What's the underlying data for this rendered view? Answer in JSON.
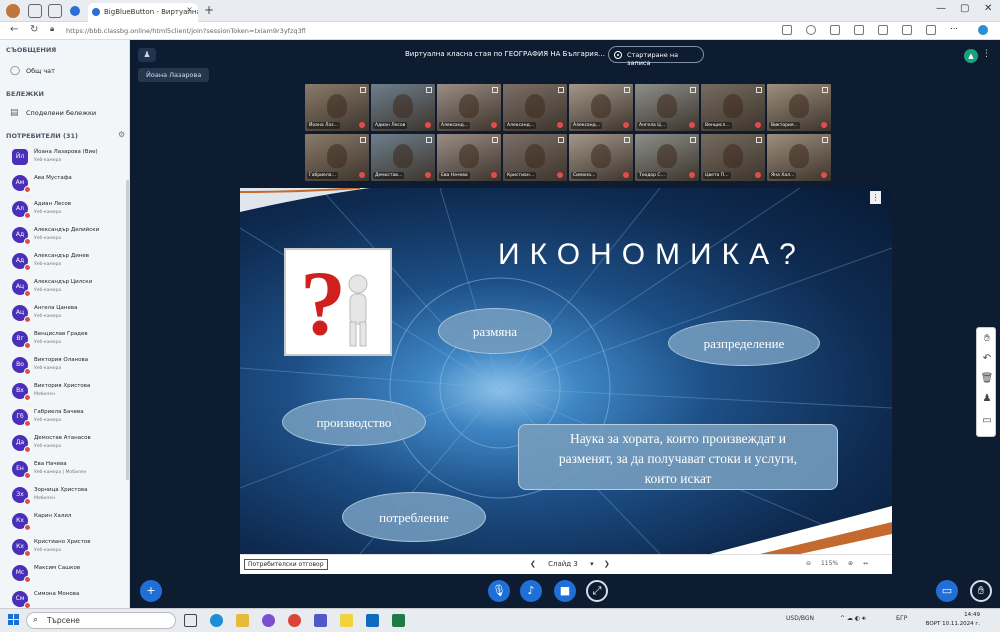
{
  "browser": {
    "tab_title": "BigBlueButton - Виртуална …",
    "tab_close": "×",
    "new_tab": "+",
    "url": "https://bbb.classbg.online/html5client/join?sessionToken=txiam9r3yfzq3fl"
  },
  "sidebar": {
    "messages_header": "СЪОБЩЕНИЯ",
    "public_chat": "Общ чат",
    "notes_header": "БЕЛЕЖКИ",
    "shared_notes": "Споделени бележки",
    "users_header": "ПОТРЕБИТЕЛИ (31)",
    "users": [
      {
        "initials": "Йл",
        "name": "Йоана Лазарова (Вие)",
        "sub": "Уеб-камера",
        "mod": true
      },
      {
        "initials": "Ам",
        "name": "Ава Мустафа",
        "sub": "",
        "mod": false
      },
      {
        "initials": "Ал",
        "name": "Адиан Лесов",
        "sub": "Уеб-камера",
        "mod": false
      },
      {
        "initials": "Ад",
        "name": "Александър Делийски",
        "sub": "Уеб-камера",
        "mod": false
      },
      {
        "initials": "Ад",
        "name": "Александър Динев",
        "sub": "Уеб-камера",
        "mod": false
      },
      {
        "initials": "Ац",
        "name": "Александър Цилски",
        "sub": "Уеб-камера",
        "mod": false
      },
      {
        "initials": "Ац",
        "name": "Ангела Цанева",
        "sub": "Уеб-камера",
        "mod": false
      },
      {
        "initials": "Вг",
        "name": "Венцислав Градев",
        "sub": "Уеб-камера",
        "mod": false
      },
      {
        "initials": "Во",
        "name": "Виктория Оланова",
        "sub": "Уеб-камера",
        "mod": false
      },
      {
        "initials": "Вх",
        "name": "Виктория Христова",
        "sub": "Мобилен",
        "mod": false
      },
      {
        "initials": "Гб",
        "name": "Габриела Бачева",
        "sub": "Уеб-камера",
        "mod": false
      },
      {
        "initials": "Да",
        "name": "Демостав Атанасов",
        "sub": "Уеб-камера",
        "mod": false
      },
      {
        "initials": "Ен",
        "name": "Ева Начева",
        "sub": "Уеб-камера | Мобилен",
        "mod": false
      },
      {
        "initials": "Зх",
        "name": "Зорница Христова",
        "sub": "Мобилен",
        "mod": false
      },
      {
        "initials": "Кх",
        "name": "Карин Халил",
        "sub": "",
        "mod": false
      },
      {
        "initials": "Кх",
        "name": "Кристиано Христов",
        "sub": "Уеб-камера",
        "mod": false
      },
      {
        "initials": "Мс",
        "name": "Максим Сашков",
        "sub": "",
        "mod": false
      },
      {
        "initials": "См",
        "name": "Симона Монова",
        "sub": "",
        "mod": false
      }
    ]
  },
  "main": {
    "meeting_title": "Виртуална класна стая по ГЕОГРАФИЯ НА България…",
    "record_label": "Стартиране на записа",
    "presenter_name": "Йоана Лазарова",
    "videos": [
      "Йоана Лаз…",
      "Адиан Лесов",
      "Александ…",
      "Александ…",
      "Александ…",
      "Ангела Ц…",
      "Венцисл…",
      "Виктория…",
      "Габриела…",
      "Демостав…",
      "Ева Начева",
      "Кристиан…",
      "Симона…",
      "Теодор С…",
      "Цвета П…",
      "Яна Хал…"
    ]
  },
  "slide": {
    "title": "ИКОНОМИКА?",
    "exchange": "размяна",
    "distribution": "разпределение",
    "production": "производство",
    "consumption": "потребление",
    "definition_line1": "Наука за хората, които произвеждат и",
    "definition_line2": "разменят, за да получават стоки и услуги,",
    "definition_line3": "които искат",
    "user_answer_btn": "Потребителски отговор",
    "slide_select": "Слайд 3",
    "zoom_level": "115%"
  },
  "taskbar": {
    "search_placeholder": "Търсене",
    "tray_currency": "USD/BGN",
    "tray_lang": "БГР",
    "clock_time": "14:49",
    "clock_date": "ВОРТ 10.11.2024 г."
  },
  "colors": {
    "sidebar_bg": "#f3f6f9",
    "main_bg": "#0d1c31",
    "avatar": "#4b2fb8",
    "mic_muted": "#e14c4c",
    "accent_blue": "#1f6fd6"
  }
}
